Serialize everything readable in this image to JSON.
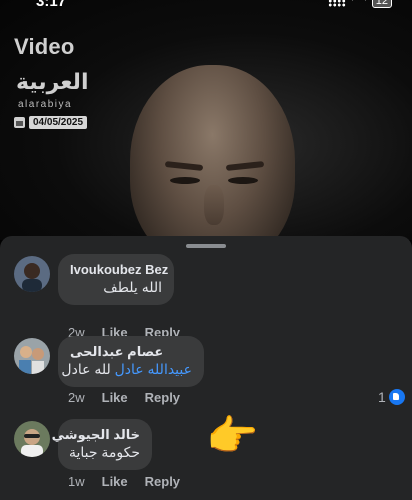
{
  "status_bar": {
    "time": "3:17",
    "battery": "12"
  },
  "video": {
    "label": "Video",
    "logo_arabic": "العربية",
    "logo_latin": "alarabiya",
    "date": "04/05/2025"
  },
  "comments": [
    {
      "author": "Ivoukoubez Bez",
      "text": "الله يلطف",
      "mention": "",
      "age": "2w",
      "like_label": "Like",
      "reply_label": "Reply"
    },
    {
      "author": "عصام عبدالحى",
      "text": "لله عادل",
      "mention": "عبيدالله عادل",
      "age": "2w",
      "like_label": "Like",
      "reply_label": "Reply",
      "reactions": "1"
    },
    {
      "author": "خالد الجيوشي",
      "text": "حكومة جباية",
      "mention": "",
      "age": "1w",
      "like_label": "Like",
      "reply_label": "Reply"
    }
  ],
  "icons": {
    "reaction": "like-icon",
    "pointing_emoji": "👉"
  },
  "colors": {
    "sheet_bg": "#242526",
    "bubble_bg": "#3a3b3c",
    "mention": "#4599ff",
    "like_blue": "#1877f2"
  }
}
